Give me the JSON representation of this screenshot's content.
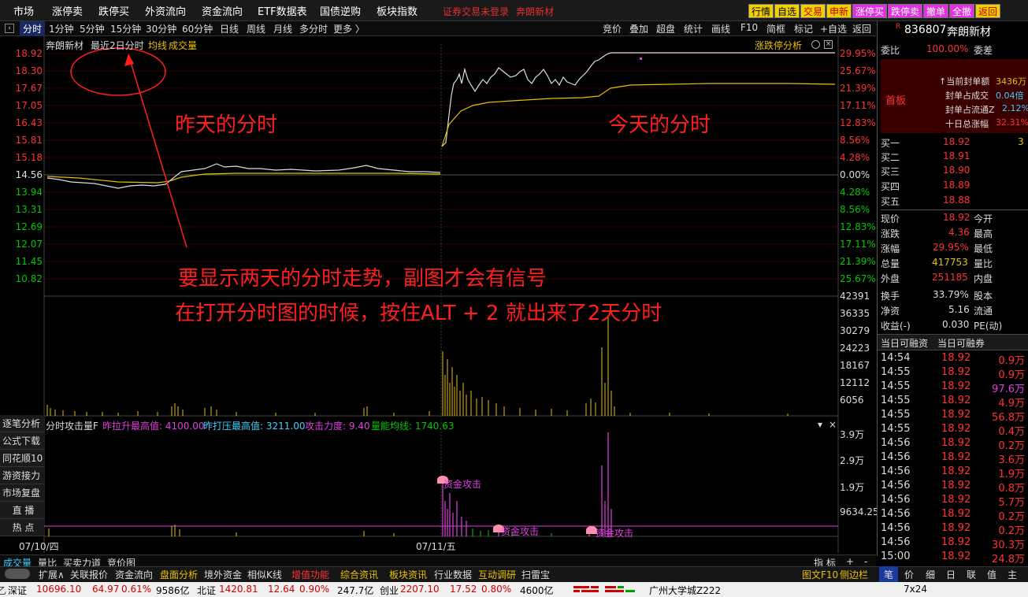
{
  "topbar": {
    "menus": [
      "市场",
      "涨停卖",
      "跌停买",
      "外资流向",
      "资金流向",
      "ETF数据表",
      "国债逆购",
      "板块指数"
    ],
    "warning": "证券交易未登录",
    "stock_title": "奔朗新材",
    "buttons": [
      "行情",
      "自选",
      "交易",
      "申新",
      "涨停买",
      "跌停卖",
      "撤单",
      "全撤",
      "返回"
    ]
  },
  "period": {
    "tabs": [
      "分时",
      "1分钟",
      "5分钟",
      "15分钟",
      "30分钟",
      "60分钟",
      "日线",
      "周线",
      "月线",
      "多分时",
      "更多 〉"
    ],
    "tools": [
      "竞价",
      "叠加",
      "超盘",
      "统计",
      "画线",
      "F10",
      "简框",
      "标记",
      "+自选",
      "返回"
    ]
  },
  "chart_header": {
    "name": "奔朗新材",
    "mode": "最近2日分时",
    "avg": "均线",
    "vol": "成交量",
    "analysis": "涨跌停分析"
  },
  "price_axis": {
    "left": [
      "18.92",
      "18.30",
      "17.67",
      "17.05",
      "16.43",
      "15.81",
      "15.18",
      "14.56",
      "13.94",
      "13.31",
      "12.69",
      "12.07",
      "11.45",
      "10.82"
    ],
    "right": [
      "29.95%",
      "25.67%",
      "21.39%",
      "17.11%",
      "12.83%",
      "8.56%",
      "4.28%",
      "0.00%",
      "4.28%",
      "8.56%",
      "12.83%",
      "17.11%",
      "21.39%",
      "25.67%"
    ]
  },
  "vol_axis": [
    "42391",
    "36335",
    "30279",
    "24223",
    "18167",
    "12112",
    "6056"
  ],
  "ind_axis": [
    "3.9万",
    "2.9万",
    "1.9万",
    "9634.25"
  ],
  "indicator_header": {
    "name": "分时攻击量F",
    "f1": "昨拉升最高值: 4100.00",
    "f2": "昨打压最高值: 3211.00",
    "f3": "攻击力度: 9.40",
    "f4": "量能均线: 1740.63"
  },
  "signals": [
    "资金攻击",
    "资金攻击",
    "资金攻击"
  ],
  "dates": [
    "07/10/四",
    "07/11/五"
  ],
  "sidebar": [
    "逐笔分析",
    "公式下载",
    "同花顺10",
    "游资接力",
    "市场复盘",
    "直 播",
    "热 点"
  ],
  "annotations": {
    "yesterday": "昨天的分时",
    "today": "今天的分时",
    "line1": "要显示两天的分时走势，副图才会有信号",
    "line2": "在打开分时图的时候，按住ALT + 2  就出来了2天分时"
  },
  "right_panel": {
    "flag": "R",
    "code": "836807",
    "name": "奔朗新材",
    "weibi_label": "委比",
    "weibi": "100.00%",
    "weicha_label": "委差",
    "board": "首板",
    "seal": [
      {
        "label": "↑当前封单额",
        "value": "3436万"
      },
      {
        "label": "封单占成交",
        "value": "0.04倍"
      },
      {
        "label": "封单占流通Z",
        "value": "2.12%"
      },
      {
        "label": "十日总涨幅",
        "value": "32.31%"
      }
    ],
    "bids": [
      {
        "label": "买一",
        "price": "18.92",
        "vol": "3"
      },
      {
        "label": "买二",
        "price": "18.91",
        "vol": ""
      },
      {
        "label": "买三",
        "price": "18.90",
        "vol": ""
      },
      {
        "label": "买四",
        "price": "18.89",
        "vol": ""
      },
      {
        "label": "买五",
        "price": "18.88",
        "vol": ""
      }
    ],
    "quote": [
      {
        "l": "现价",
        "v": "18.92",
        "r": "今开"
      },
      {
        "l": "涨跌",
        "v": "4.36",
        "r": "最高"
      },
      {
        "l": "涨幅",
        "v": "29.95%",
        "r": "最低"
      },
      {
        "l": "总量",
        "v": "417753",
        "r": "量比"
      },
      {
        "l": "外盘",
        "v": "251185",
        "r": "内盘"
      },
      {
        "l": "换手",
        "v": "33.79%",
        "r": "股本"
      },
      {
        "l": "净资",
        "v": "5.16",
        "r": "流通"
      },
      {
        "l": "收益(-)",
        "v": "0.030",
        "r": "PE(动)"
      }
    ],
    "finance_tabs": [
      "当日可融资",
      "当日可融券"
    ],
    "ticks": [
      {
        "t": "14:54",
        "p": "18.92",
        "v": "0.9万"
      },
      {
        "t": "14:55",
        "p": "18.92",
        "v": "0.9万"
      },
      {
        "t": "14:55",
        "p": "18.92",
        "v": "97.6万"
      },
      {
        "t": "14:55",
        "p": "18.92",
        "v": "4.9万"
      },
      {
        "t": "14:55",
        "p": "18.92",
        "v": "56.8万"
      },
      {
        "t": "14:55",
        "p": "18.92",
        "v": "0.4万"
      },
      {
        "t": "14:56",
        "p": "18.92",
        "v": "0.2万"
      },
      {
        "t": "14:56",
        "p": "18.92",
        "v": "3.6万"
      },
      {
        "t": "14:56",
        "p": "18.92",
        "v": "1.9万"
      },
      {
        "t": "14:56",
        "p": "18.92",
        "v": "0.8万"
      },
      {
        "t": "14:56",
        "p": "18.92",
        "v": "5.7万"
      },
      {
        "t": "14:56",
        "p": "18.92",
        "v": "0.2万"
      },
      {
        "t": "14:56",
        "p": "18.92",
        "v": "0.2万"
      },
      {
        "t": "14:56",
        "p": "18.92",
        "v": "30.3万"
      },
      {
        "t": "15:00",
        "p": "18.92",
        "v": "24.8万"
      }
    ]
  },
  "bottom_tabs": [
    "成交量",
    "量比",
    "买卖力道",
    "竞价图"
  ],
  "bottom_right": [
    "指 标",
    "+",
    "-"
  ],
  "function_bar": [
    "扩展∧",
    "关联报价",
    "资金流向",
    "盘面分析",
    "境外资金",
    "相似K线",
    "增值功能",
    "综合资讯",
    "板块资讯",
    "行业数据",
    "互动调研",
    "扫雷宝",
    "图文F10",
    "侧边栏"
  ],
  "function_right": [
    "笔",
    "价",
    "细",
    "日",
    "联",
    "值",
    "主"
  ],
  "ticker": {
    "sz_label": "深证",
    "sz": "10696.10",
    "sz_chg": "64.97",
    "sz_pct": "0.61%",
    "sz_amt": "9586亿",
    "bz_label": "北证",
    "bz": "1420.81",
    "bz_chg": "12.64",
    "bz_pct": "0.90%",
    "bz_amt": "247.7亿",
    "cy_label": "创业",
    "cy": "2207.10",
    "cy_chg": "17.52",
    "cy_pct": "0.80%",
    "cy_amt": "4600亿",
    "location": "广州大学城Z222",
    "clock": "7x24"
  }
}
